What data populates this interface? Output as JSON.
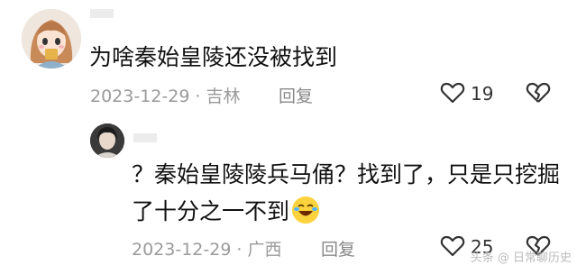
{
  "comment1": {
    "username": "",
    "text": "为啥秦始皇陵还没被找到",
    "date": "2023-12-29",
    "location": "吉林",
    "reply_label": "回复",
    "likes": "19"
  },
  "comment2": {
    "username": "",
    "text_line1": "？秦始皇陵陵兵马俑？找到了，只是只挖掘",
    "text_line2": "了十分之一不到",
    "date": "2023-12-29",
    "location": "广西",
    "reply_label": "回复",
    "likes": "25"
  },
  "separator": "·",
  "icons": {
    "like": "heart-outline-icon",
    "dislike": "broken-heart-icon",
    "emoji": "crying-laughing-emoji-icon"
  },
  "watermark": "头条 @ 日常聊历史"
}
